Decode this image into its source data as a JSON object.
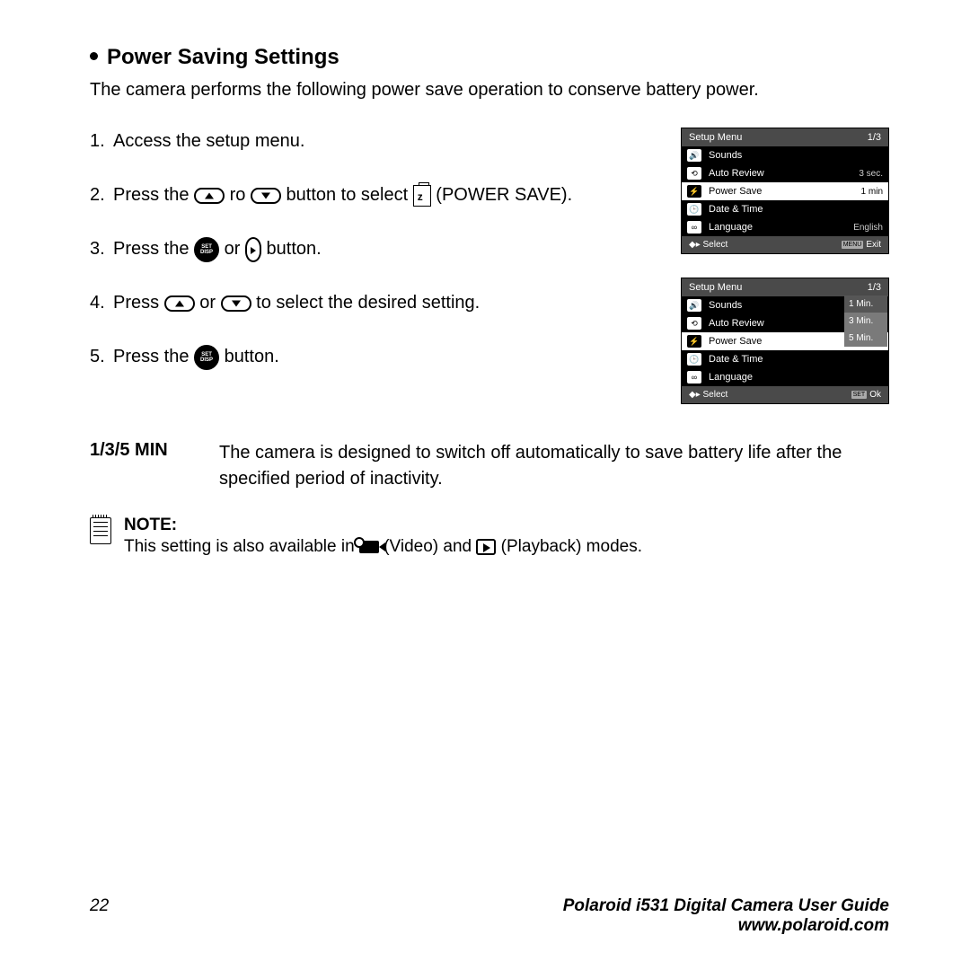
{
  "heading": "Power Saving Settings",
  "intro": "The camera performs the following power save operation to conserve battery power.",
  "steps": {
    "s1": "Access the setup menu.",
    "s2a": "Press the ",
    "s2b": " ro ",
    "s2c": " button to select ",
    "s2d": " (POWER SAVE).",
    "s3a": "Press the ",
    "s3b": " or ",
    "s3c": " button.",
    "s4a": "Press ",
    "s4b": " or ",
    "s4c": " to select the desired setting.",
    "s5a": "Press the ",
    "s5b": " button."
  },
  "screen1": {
    "title": "Setup Menu",
    "page": "1/3",
    "rows": [
      {
        "label": "Sounds",
        "val": ""
      },
      {
        "label": "Auto Review",
        "val": "3 sec."
      },
      {
        "label": "Power Save",
        "val": "1 min"
      },
      {
        "label": "Date & Time",
        "val": ""
      },
      {
        "label": "Language",
        "val": "English"
      }
    ],
    "foot_l": "Select",
    "foot_r": "Exit",
    "foot_r_badge": "MENU"
  },
  "screen2": {
    "title": "Setup Menu",
    "page": "1/3",
    "rows": [
      {
        "label": "Sounds"
      },
      {
        "label": "Auto Review"
      },
      {
        "label": "Power Save"
      },
      {
        "label": "Date & Time"
      },
      {
        "label": "Language"
      }
    ],
    "options": [
      "1 Min.",
      "3 Min.",
      "5 Min."
    ],
    "foot_l": "Select",
    "foot_r": "Ok",
    "foot_r_badge": "SET"
  },
  "desc": {
    "key": "1/3/5 MIN",
    "val": "The camera is designed to switch off automatically to save battery life after the specified period of inactivity."
  },
  "note": {
    "title": "NOTE:",
    "a": "This setting is also available in ",
    "b": " (Video) and ",
    "c": " (Playback) modes."
  },
  "footer": {
    "page": "22",
    "guide": "Polaroid i531 Digital Camera User Guide",
    "url": "www.polaroid.com"
  }
}
